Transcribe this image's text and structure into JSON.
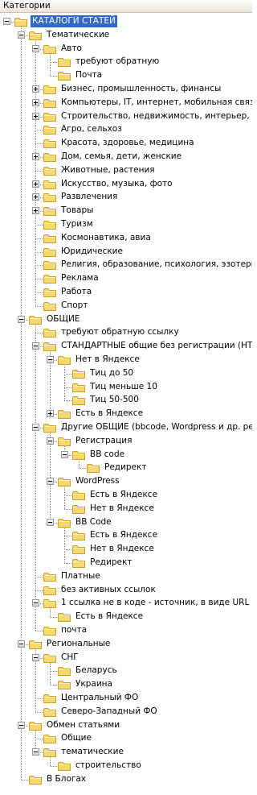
{
  "header": {
    "title": "Категории"
  },
  "tree": [
    {
      "label": "КАТАЛОГИ СТАТЕЙ",
      "depth": 0,
      "expanded": true,
      "selected": true
    },
    {
      "label": "Тематические",
      "depth": 1,
      "expanded": true
    },
    {
      "label": "Авто",
      "depth": 2,
      "expanded": true
    },
    {
      "label": "требуют обратную",
      "depth": 3
    },
    {
      "label": "Почта",
      "depth": 3
    },
    {
      "label": "Бизнес, промышленность, финансы",
      "depth": 2,
      "expanded": false
    },
    {
      "label": "Компьютеры, IT, интернет, мобильная связь",
      "depth": 2,
      "expanded": false
    },
    {
      "label": "Строительство, недвижимость, интерьер, мебель",
      "depth": 2,
      "expanded": false
    },
    {
      "label": "Агро, сельхоз",
      "depth": 2
    },
    {
      "label": "Красота, здоровье, медицина",
      "depth": 2
    },
    {
      "label": "Дом, семья, дети, женские",
      "depth": 2,
      "expanded": false
    },
    {
      "label": "Животные, растения",
      "depth": 2
    },
    {
      "label": "Искусство, музыка, фото",
      "depth": 2,
      "expanded": false
    },
    {
      "label": "Развлечения",
      "depth": 2,
      "expanded": false
    },
    {
      "label": "Товары",
      "depth": 2,
      "expanded": false
    },
    {
      "label": "Туризм",
      "depth": 2
    },
    {
      "label": "Космонавтика, авиа",
      "depth": 2
    },
    {
      "label": "Юридические",
      "depth": 2
    },
    {
      "label": "Религия, образование, психология, эзотерика",
      "depth": 2
    },
    {
      "label": "Реклама",
      "depth": 2
    },
    {
      "label": "Работа",
      "depth": 2
    },
    {
      "label": "Спорт",
      "depth": 2
    },
    {
      "label": "ОБЩИЕ",
      "depth": 1,
      "expanded": true
    },
    {
      "label": "требуют обратную ссылку",
      "depth": 2
    },
    {
      "label": "СТАНДАРТНЫЕ общие без регистрации (HTML)",
      "depth": 2,
      "expanded": true
    },
    {
      "label": "Нет в Яндексе",
      "depth": 3,
      "expanded": true
    },
    {
      "label": "Тиц до 50",
      "depth": 4
    },
    {
      "label": "Тиц меньше 10",
      "depth": 4
    },
    {
      "label": "Тиц 50-500",
      "depth": 4
    },
    {
      "label": "Есть в Яндексе",
      "depth": 3,
      "expanded": false
    },
    {
      "label": "Другие ОБЩИЕ (bbcode, Wordpress и др. регистрация)",
      "depth": 2,
      "expanded": true
    },
    {
      "label": "Регистрация",
      "depth": 3,
      "expanded": true
    },
    {
      "label": "BB code",
      "depth": 4,
      "expanded": true
    },
    {
      "label": "Редирект",
      "depth": 5
    },
    {
      "label": "WordPress",
      "depth": 3,
      "expanded": true
    },
    {
      "label": "Есть в Яндексе",
      "depth": 4
    },
    {
      "label": "Нет в Яндексе",
      "depth": 4
    },
    {
      "label": "BB Code",
      "depth": 3,
      "expanded": true
    },
    {
      "label": "Есть в Яндексе",
      "depth": 4
    },
    {
      "label": "Нет в Яндексе",
      "depth": 4
    },
    {
      "label": "Редирект",
      "depth": 4
    },
    {
      "label": "Платные",
      "depth": 2
    },
    {
      "label": "без активных ссылок",
      "depth": 2
    },
    {
      "label": "1 ссылка не в коде - источник, в виде URL",
      "depth": 2,
      "expanded": true
    },
    {
      "label": "Есть в Яндексе",
      "depth": 3
    },
    {
      "label": "почта",
      "depth": 2
    },
    {
      "label": "Региональные",
      "depth": 1,
      "expanded": true
    },
    {
      "label": "СНГ",
      "depth": 2,
      "expanded": true
    },
    {
      "label": "Беларусь",
      "depth": 3
    },
    {
      "label": "Украина",
      "depth": 3
    },
    {
      "label": "Центральный ФО",
      "depth": 2
    },
    {
      "label": "Северо-Западный ФО",
      "depth": 2
    },
    {
      "label": "Обмен статьями",
      "depth": 1,
      "expanded": true
    },
    {
      "label": "Общие",
      "depth": 2
    },
    {
      "label": "тематические",
      "depth": 2,
      "expanded": true
    },
    {
      "label": "строительство",
      "depth": 3
    },
    {
      "label": "В Блогах",
      "depth": 1
    }
  ],
  "colors": {
    "folder_fill": "#f7d774",
    "folder_edge": "#c9a227",
    "selection": "#316ac5",
    "tree_line": "#8a8a8a"
  },
  "icons": {
    "folder": "folder-icon",
    "expand": "expand-toggle-icon"
  }
}
